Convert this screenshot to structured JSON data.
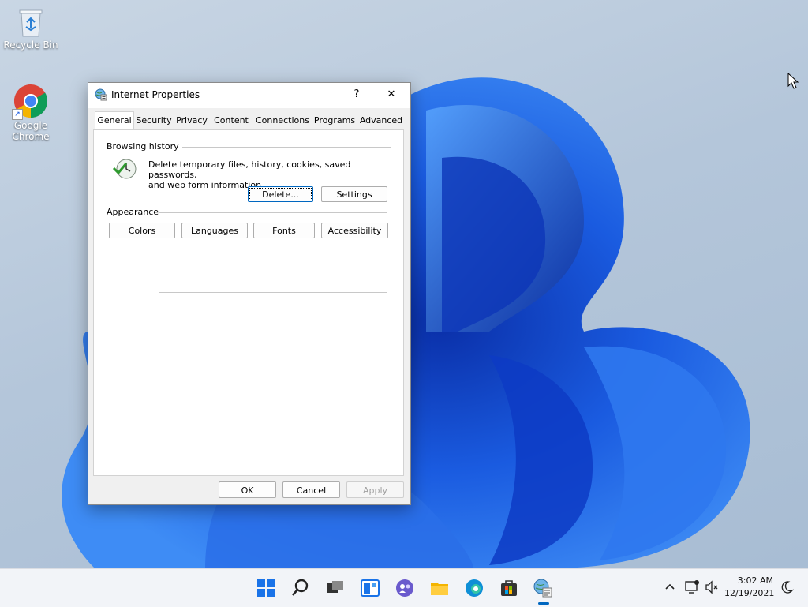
{
  "desktop": {
    "icons": [
      {
        "label": "Recycle Bin"
      },
      {
        "label_line1": "Google",
        "label_line2": "Chrome"
      }
    ]
  },
  "dialog": {
    "title": "Internet Properties",
    "help_label": "?",
    "close_label": "✕",
    "tabs": [
      "General",
      "Security",
      "Privacy",
      "Content",
      "Connections",
      "Programs",
      "Advanced"
    ],
    "active_tab": "General",
    "browsing_history": {
      "heading": "Browsing history",
      "description_line1": "Delete temporary files, history, cookies, saved passwords,",
      "description_line2": "and web form information.",
      "delete_label": "Delete...",
      "settings_label": "Settings"
    },
    "appearance": {
      "heading": "Appearance",
      "buttons": [
        "Colors",
        "Languages",
        "Fonts",
        "Accessibility"
      ]
    },
    "footer": {
      "ok_label": "OK",
      "cancel_label": "Cancel",
      "apply_label": "Apply"
    }
  },
  "taskbar": {
    "icons": [
      "start-icon",
      "search-icon",
      "task-view-icon",
      "widgets-icon",
      "chat-icon",
      "file-explorer-icon",
      "edge-icon",
      "store-icon",
      "internet-properties-icon"
    ],
    "clock_time": "3:02 AM",
    "clock_date": "12/19/2021"
  },
  "colors": {
    "accent": "#0067c0",
    "wallpaper_bloom": "#1a5be0",
    "taskbar_bg": "#f2f4f8"
  }
}
